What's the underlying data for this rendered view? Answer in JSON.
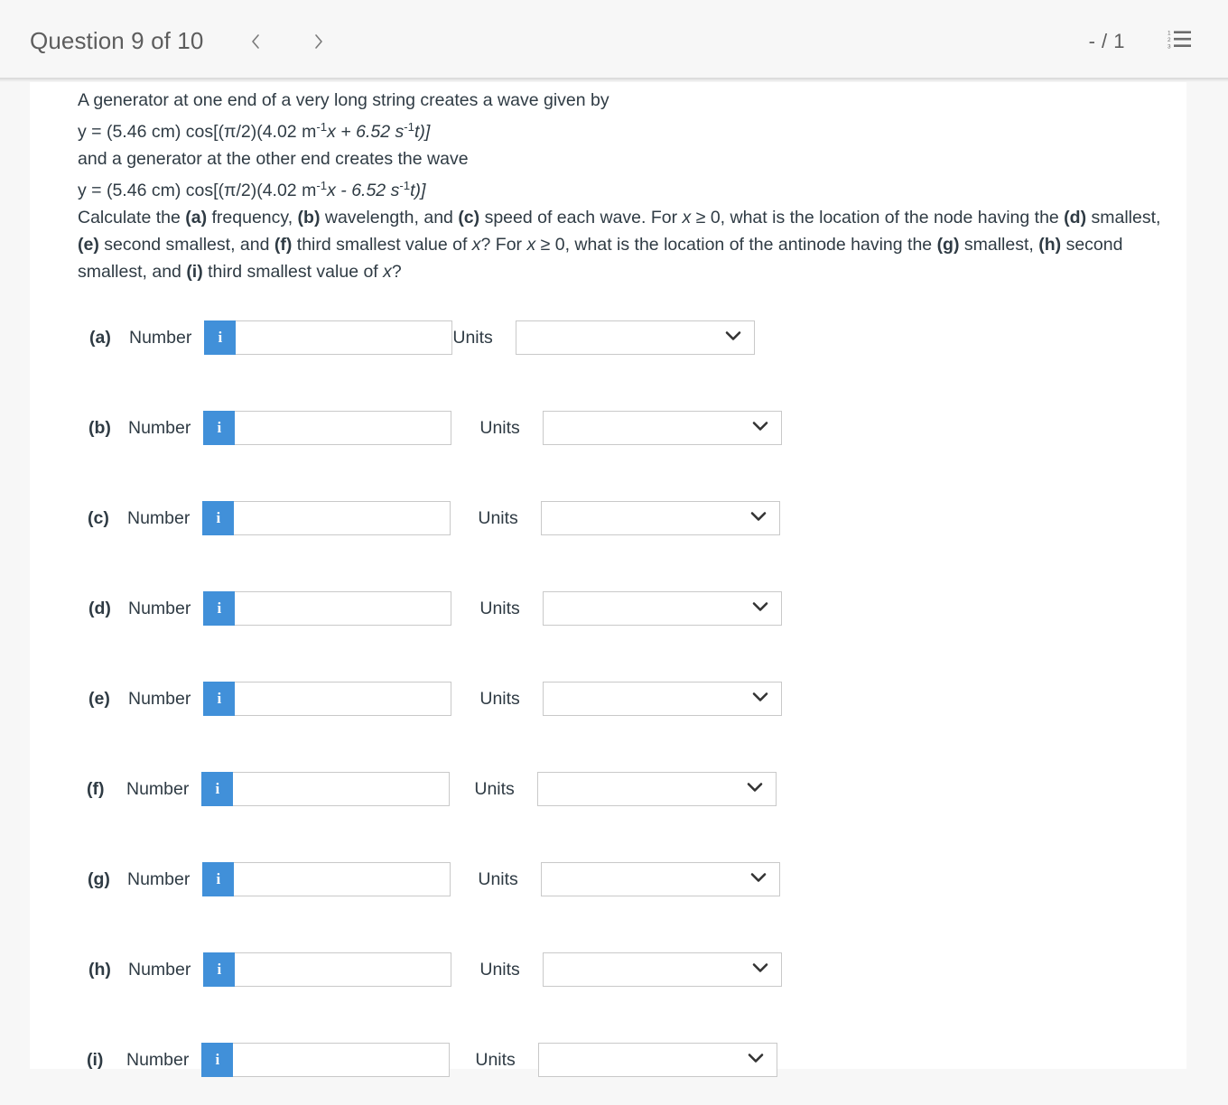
{
  "header": {
    "title": "Question 9 of 10",
    "prev_icon": "chevron-left-icon",
    "next_icon": "chevron-right-icon",
    "score": "- / 1",
    "list_icon": "numbered-list-icon",
    "list_numbers": [
      "1",
      "2",
      "3"
    ],
    "title_color": "#5d5d5d",
    "background": "#f7f7f7"
  },
  "question": {
    "line1": "A generator at one end of a very long string creates a wave given by",
    "eq1": {
      "lead": "y = (5.46 cm) cos[(π/2)(4.02 m",
      "sup1": "-1",
      "mid": "x + 6.52 s",
      "sup2": "-1",
      "tail": "t)]"
    },
    "line2": "and a generator at the other end creates the wave",
    "eq2": {
      "lead": "y = (5.46 cm) cos[(π/2)(4.02 m",
      "sup1": "-1",
      "mid": "x - 6.52 s",
      "sup2": "-1",
      "tail": "t)]"
    },
    "prompt": {
      "p1": "Calculate the ",
      "a": "(a)",
      "p2": " frequency, ",
      "b": "(b)",
      "p3": " wavelength, and ",
      "c": "(c)",
      "p4": " speed of each wave. For ",
      "x1": "x",
      "p5": " ≥ 0, what is the location of the node having the ",
      "d": "(d)",
      "p6": " smallest, ",
      "e": "(e)",
      "p7": " second smallest, and ",
      "f": "(f)",
      "p8": " third smallest value of ",
      "x2": "x",
      "p9": "? For ",
      "x3": "x",
      "p10": " ≥ 0, what is the location of the antinode having the ",
      "g": "(g)",
      "p11": " smallest, ",
      "h": "(h)",
      "p12": " second smallest, and ",
      "i": "(i)",
      "p13": " third smallest value of ",
      "x4": "x",
      "p14": "?"
    },
    "text_color": "#2f3b44"
  },
  "answers": {
    "number_label": "Number",
    "units_label": "Units",
    "info_icon": "info-icon",
    "info_glyph": "i",
    "info_color": "#4190d9",
    "chevron_icon": "chevron-down-icon",
    "rows": [
      {
        "label": "(a)",
        "number_value": "",
        "number_placeholder": "",
        "units_value": "",
        "units_placeholder": ""
      },
      {
        "label": "(b)",
        "number_value": "",
        "number_placeholder": "",
        "units_value": "",
        "units_placeholder": ""
      },
      {
        "label": "(c)",
        "number_value": "",
        "number_placeholder": "",
        "units_value": "",
        "units_placeholder": ""
      },
      {
        "label": "(d)",
        "number_value": "",
        "number_placeholder": "",
        "units_value": "",
        "units_placeholder": ""
      },
      {
        "label": "(e)",
        "number_value": "",
        "number_placeholder": "",
        "units_value": "",
        "units_placeholder": ""
      },
      {
        "label": "(f)",
        "number_value": "",
        "number_placeholder": "",
        "units_value": "",
        "units_placeholder": ""
      },
      {
        "label": "(g)",
        "number_value": "",
        "number_placeholder": "",
        "units_value": "",
        "units_placeholder": ""
      },
      {
        "label": "(h)",
        "number_value": "",
        "number_placeholder": "",
        "units_value": "",
        "units_placeholder": ""
      },
      {
        "label": "(i)",
        "number_value": "",
        "number_placeholder": "",
        "units_value": "",
        "units_placeholder": ""
      }
    ]
  }
}
